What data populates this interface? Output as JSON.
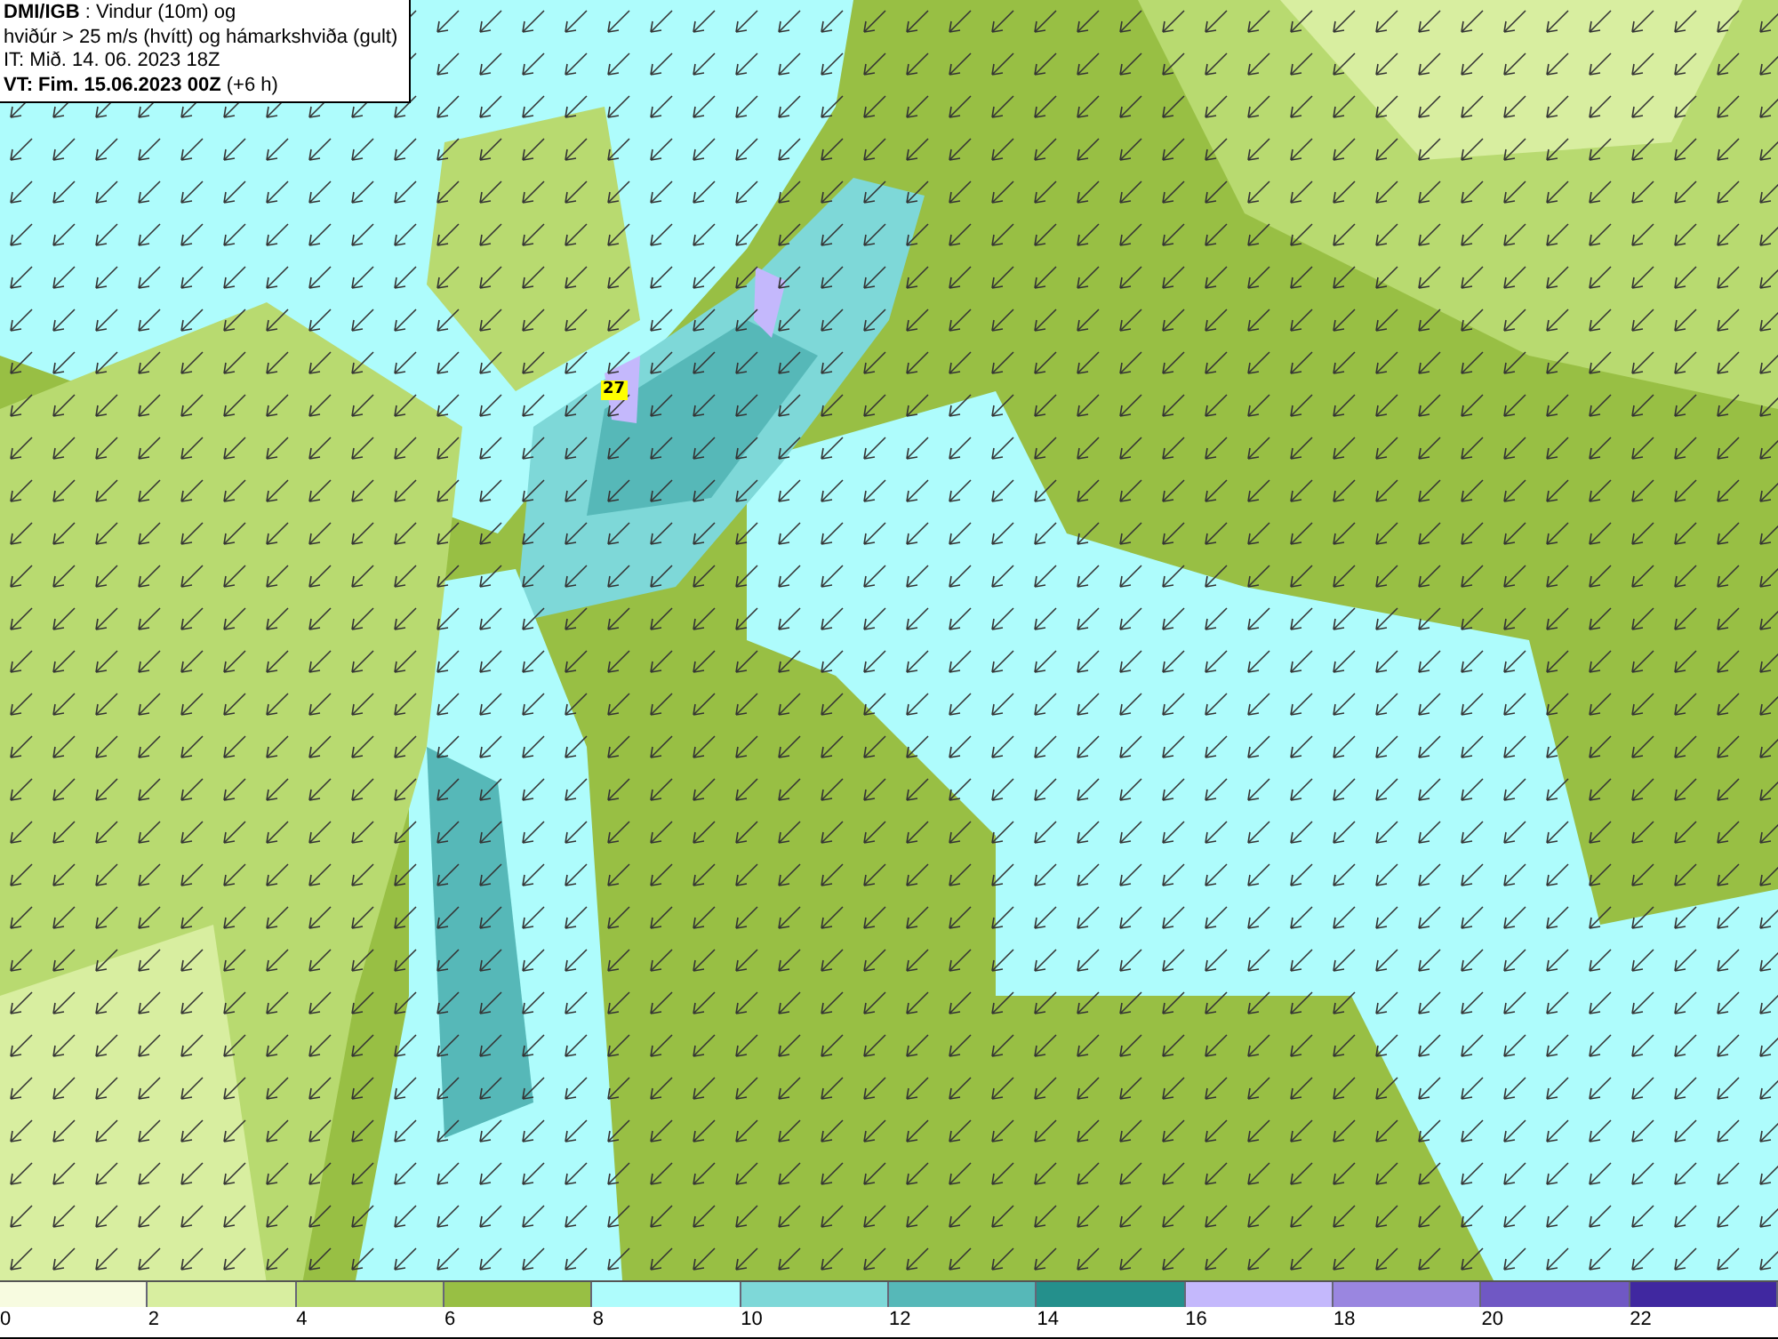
{
  "header": {
    "lines": [
      "**DMI/IGB** : Vindur (10m) og",
      "hviðúr > 25 m/s (hvítt) og hámarkshviða (gult)",
      "IT: Mið. 14. 06. 2023 18Z",
      "**VT: Fim. 15.06.2023 00Z** (+6 h)"
    ]
  },
  "map": {
    "gust_labels": [
      {
        "text": "27",
        "color": "#ffff00"
      }
    ]
  },
  "legend": {
    "bins": [
      {
        "color": "#f7fbe0",
        "label": "0"
      },
      {
        "color": "#d8eea0",
        "label": "2"
      },
      {
        "color": "#b8da70",
        "label": "4"
      },
      {
        "color": "#98bf44",
        "label": "6"
      },
      {
        "color": "#aefcfc",
        "label": "8"
      },
      {
        "color": "#7ed8d8",
        "label": "10"
      },
      {
        "color": "#56b8b8",
        "label": "12"
      },
      {
        "color": "#24908c",
        "label": "14"
      },
      {
        "color": "#c4b8fc",
        "label": "16"
      },
      {
        "color": "#9a86e0",
        "label": "18"
      },
      {
        "color": "#7058c4",
        "label": "20"
      },
      {
        "color": "#4028a0",
        "label": "22"
      }
    ]
  }
}
